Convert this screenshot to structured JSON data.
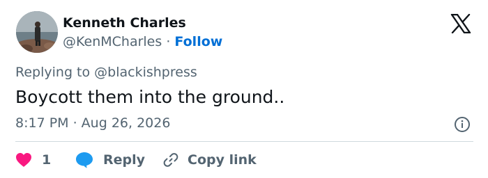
{
  "author": {
    "name": "Kenneth Charles",
    "handle": "@KenMCharles",
    "separator": "·",
    "follow_label": "Follow"
  },
  "tweet": {
    "replying_to": "Replying to @blackishpress",
    "text": "Boycott them into the ground..",
    "timestamp": "8:17 PM · Aug 26, 2026"
  },
  "actions": {
    "like_count": "1",
    "reply_label": "Reply",
    "copy_label": "Copy link"
  },
  "icons": {
    "brand": "x-logo-icon",
    "info": "info-icon",
    "like": "heart-icon",
    "reply": "speech-bubble-icon",
    "copy": "link-icon"
  },
  "colors": {
    "like": "#f91880",
    "reply": "#1d9bf0",
    "follow": "#006fd6",
    "muted": "#536471",
    "text": "#0f1419"
  }
}
